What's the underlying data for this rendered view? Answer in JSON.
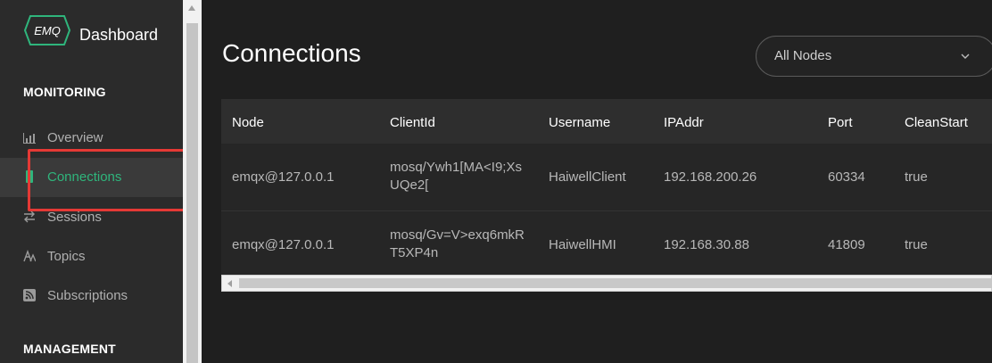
{
  "brand": {
    "logo_text": "EMQ",
    "title": "Dashboard"
  },
  "sidebar": {
    "monitoring_label": "MONITORING",
    "management_label": "MANAGEMENT",
    "items": [
      {
        "label": "Overview",
        "icon": "bar-chart-icon",
        "active": false
      },
      {
        "label": "Connections",
        "icon": "connections-icon",
        "active": true
      },
      {
        "label": "Sessions",
        "icon": "swap-icon",
        "active": false
      },
      {
        "label": "Topics",
        "icon": "topics-icon",
        "active": false
      },
      {
        "label": "Subscriptions",
        "icon": "rss-icon",
        "active": false
      }
    ]
  },
  "main": {
    "title": "Connections",
    "node_select": {
      "value": "All Nodes"
    },
    "table": {
      "columns": [
        "Node",
        "ClientId",
        "Username",
        "IPAddr",
        "Port",
        "CleanStart"
      ],
      "rows": [
        {
          "node": "emqx@127.0.0.1",
          "client_id_1": "mosq/Ywh1[MA<I9;Xs",
          "client_id_2": "UQe2[",
          "username": "HaiwellClient",
          "ipaddr": "192.168.200.26",
          "port": "60334",
          "clean_start": "true"
        },
        {
          "node": "emqx@127.0.0.1",
          "client_id_1": "mosq/Gv=V>exq6mkR",
          "client_id_2": "T5XP4n",
          "username": "HaiwellHMI",
          "ipaddr": "192.168.30.88",
          "port": "41809",
          "clean_start": "true"
        }
      ]
    }
  },
  "colors": {
    "accent": "#2fb57c",
    "highlight": "#e53935",
    "background": "#1f1f1f",
    "sidebar": "#2b2b2b"
  }
}
